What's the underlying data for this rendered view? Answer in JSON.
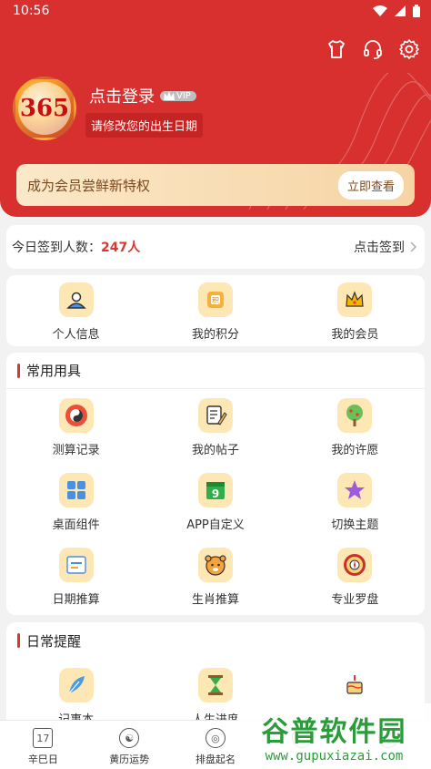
{
  "status": {
    "time": "10:56"
  },
  "header": {
    "login_label": "点击登录",
    "vip_badge": "VIP",
    "subtitle": "请修改您的出生日期",
    "avatar_text": "365",
    "member_text": "成为会员尝鲜新特权",
    "member_button": "立即查看",
    "icons": [
      "tshirt-icon",
      "headset-icon",
      "settings-icon"
    ]
  },
  "signin": {
    "label": "今日签到人数：",
    "count": "247人",
    "action": "点击签到"
  },
  "quick": [
    {
      "label": "个人信息",
      "icon": "person-icon"
    },
    {
      "label": "我的积分",
      "icon": "points-icon"
    },
    {
      "label": "我的会员",
      "icon": "crown-icon"
    }
  ],
  "tools": {
    "title": "常用用具",
    "items": [
      {
        "label": "测算记录",
        "icon": "bagua-icon"
      },
      {
        "label": "我的帖子",
        "icon": "post-icon"
      },
      {
        "label": "我的许愿",
        "icon": "wish-tree-icon"
      },
      {
        "label": "桌面组件",
        "icon": "widget-icon"
      },
      {
        "label": "APP自定义",
        "icon": "calendar-9-icon"
      },
      {
        "label": "切换主题",
        "icon": "star-icon"
      },
      {
        "label": "日期推算",
        "icon": "date-calc-icon"
      },
      {
        "label": "生肖推算",
        "icon": "tiger-icon"
      },
      {
        "label": "专业罗盘",
        "icon": "compass-icon"
      }
    ]
  },
  "remind": {
    "title": "日常提醒",
    "items": [
      {
        "label": "记事本",
        "icon": "feather-icon"
      },
      {
        "label": "人生进度",
        "icon": "hourglass-icon"
      },
      {
        "label": "",
        "icon": "cake-icon"
      }
    ]
  },
  "nav": [
    {
      "label": "辛巳日",
      "icon": "calendar-icon"
    },
    {
      "label": "黄历运势",
      "icon": "yinyang-icon"
    },
    {
      "label": "排盘起名",
      "icon": "ball-icon"
    },
    {
      "label": "",
      "icon": "tab-icon"
    },
    {
      "label": "",
      "icon": "tab-icon"
    }
  ],
  "watermark": {
    "line1": "谷普软件园",
    "line2": "www.gupuxiazai.com"
  }
}
